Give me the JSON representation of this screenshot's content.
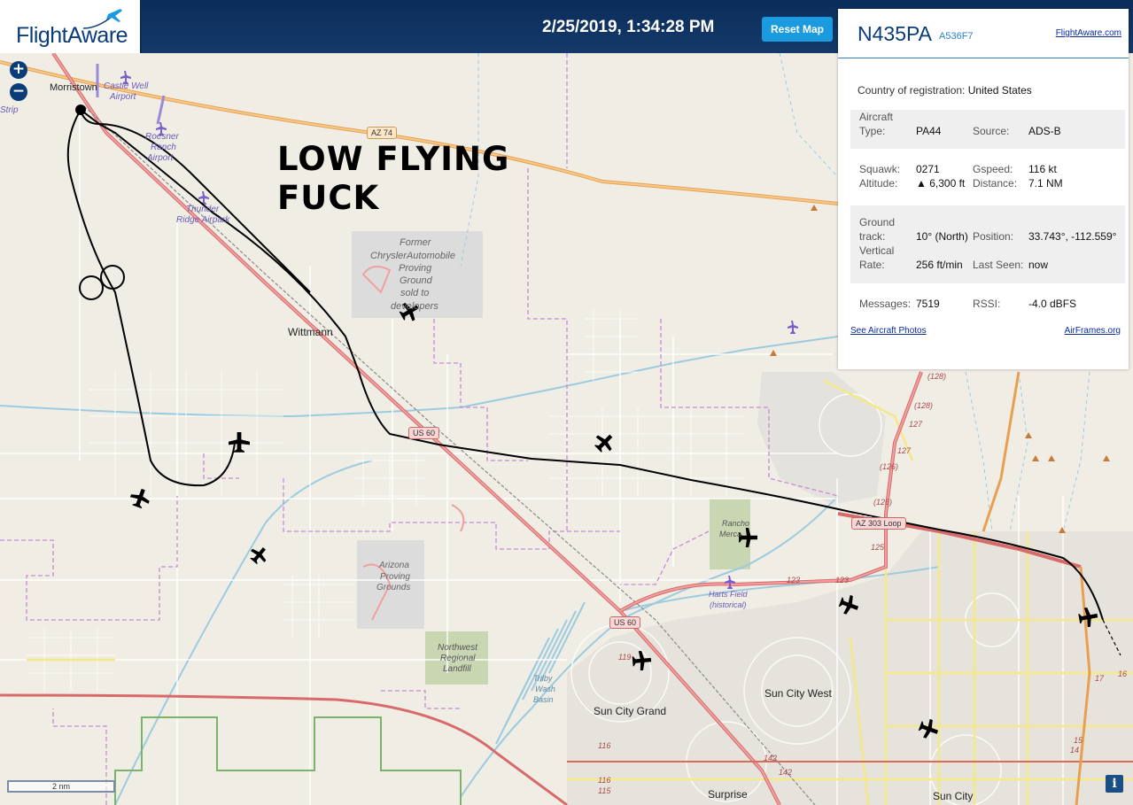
{
  "header": {
    "logo": "FlightAware",
    "datetime": "2/25/2019, 1:34:28 PM",
    "reset_label": "Reset Map"
  },
  "map": {
    "zoom_in": "+",
    "zoom_out": "−",
    "annotation_line1": "LOW FLYING",
    "annotation_line2": "FUCK",
    "scale_label": "2 nm",
    "info_label": "i",
    "places": [
      {
        "id": "morristown",
        "text": "Morristown"
      },
      {
        "id": "castle-well",
        "text": "Castle Well"
      },
      {
        "id": "castle-well2",
        "text": "Airport"
      },
      {
        "id": "strip",
        "text": "Strip"
      },
      {
        "id": "roesner1",
        "text": "Roesner"
      },
      {
        "id": "roesner2",
        "text": "Ranch"
      },
      {
        "id": "roesner3",
        "text": "Airport"
      },
      {
        "id": "thunder1",
        "text": "Thunder"
      },
      {
        "id": "thunder2",
        "text": "Ridge Airpark"
      },
      {
        "id": "former1",
        "text": "Former"
      },
      {
        "id": "former2",
        "text": "ChryslerAutomobile"
      },
      {
        "id": "former3",
        "text": "Proving"
      },
      {
        "id": "former4",
        "text": "Ground"
      },
      {
        "id": "former5",
        "text": "sold to"
      },
      {
        "id": "former6",
        "text": "developers"
      },
      {
        "id": "wittmann",
        "text": "Wittmann"
      },
      {
        "id": "az-proving1",
        "text": "Arizona"
      },
      {
        "id": "az-proving2",
        "text": "Proving"
      },
      {
        "id": "az-proving3",
        "text": "Grounds"
      },
      {
        "id": "nw-landfill1",
        "text": "Northwest"
      },
      {
        "id": "nw-landfill2",
        "text": "Regional"
      },
      {
        "id": "nw-landfill3",
        "text": "Landfill"
      },
      {
        "id": "trilby1",
        "text": "Trilby"
      },
      {
        "id": "trilby2",
        "text": "Wash"
      },
      {
        "id": "trilby3",
        "text": "Basin"
      },
      {
        "id": "rancho1",
        "text": "Rancho"
      },
      {
        "id": "rancho2",
        "text": "Merca"
      },
      {
        "id": "harts1",
        "text": "Harts Field"
      },
      {
        "id": "harts2",
        "text": "(historical)"
      },
      {
        "id": "sun-city-grand",
        "text": "Sun City Grand"
      },
      {
        "id": "sun-city-west",
        "text": "Sun City West"
      },
      {
        "id": "surprise",
        "text": "Surprise"
      },
      {
        "id": "sun-city",
        "text": "Sun City"
      }
    ],
    "road_shields": [
      {
        "id": "az74",
        "text": "AZ 74"
      },
      {
        "id": "us60a",
        "text": "US 60"
      },
      {
        "id": "us60b",
        "text": "US 60"
      },
      {
        "id": "az303",
        "text": "AZ 303 Loop"
      }
    ],
    "road_numbers": [
      "(128)",
      "(128)",
      "127",
      "127",
      "(126)",
      "(126)",
      "125",
      "123",
      "123",
      "119",
      "116",
      "116",
      "115",
      "142",
      "142",
      "17",
      "16",
      "15",
      "14"
    ]
  },
  "panel": {
    "registration": "N435PA",
    "hex": "A536F7",
    "fa_link": "FlightAware.com",
    "country_label": "Country of registration:",
    "country_value": "United States",
    "aircraft_type_label_1": "Aircraft",
    "aircraft_type_label_2": "Type:",
    "aircraft_type": "PA44",
    "source_label": "Source:",
    "source": "ADS-B",
    "squawk_label": "Squawk:",
    "squawk": "0271",
    "gspeed_label": "Gspeed:",
    "gspeed": "116 kt",
    "altitude_label": "Altitude:",
    "altitude": "▲ 6,300 ft",
    "distance_label": "Distance:",
    "distance": "7.1 NM",
    "ground_track_label_1": "Ground",
    "ground_track_label_2": "track:",
    "ground_track": "10° (North)",
    "position_label": "Position:",
    "position": "33.743°, -112.559°",
    "vertical_rate_label_1": "Vertical",
    "vertical_rate_label_2": "Rate:",
    "vertical_rate": "256 ft/min",
    "last_seen_label": "Last Seen:",
    "last_seen": "now",
    "messages_label": "Messages:",
    "messages": "7519",
    "rssi_label": "RSSI:",
    "rssi": "-4.0 dBFS",
    "photos_link": "See Aircraft Photos",
    "airframes_link": "AirFrames.org"
  },
  "colors": {
    "header_bg": "#0b2d5a",
    "accent": "#1a9be0",
    "map_bg": "#f0ede5",
    "highway": "#f5b36a",
    "us_route": "#e07a7a",
    "water": "#9ccbe0",
    "track": "#000000"
  }
}
